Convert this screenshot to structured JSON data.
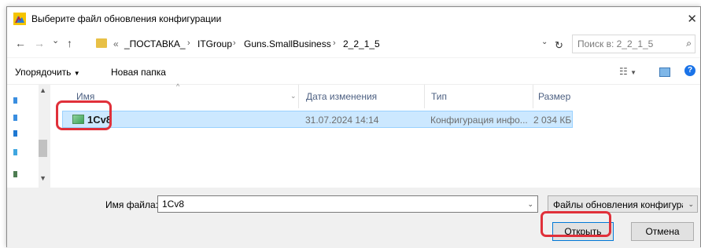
{
  "window": {
    "title": "Выберите файл обновления конфигурации",
    "close_glyph": "✕"
  },
  "nav": {
    "back_glyph": "←",
    "forward_glyph": "→",
    "recent_glyph": "⌄",
    "up_glyph": "↑",
    "overflow": "«",
    "path": [
      "_ПОСТАВКА_",
      "ITGroup",
      "Guns.SmallBusiness",
      "2_2_1_5"
    ],
    "path_separator": "›",
    "refresh_glyph": "↻",
    "search_placeholder": "Поиск в: 2_2_1_5",
    "search_glyph": "⌕"
  },
  "toolbar": {
    "organize_label": "Упорядочить",
    "new_folder_label": "Новая папка"
  },
  "columns": {
    "name": "Имя",
    "date": "Дата изменения",
    "type": "Тип",
    "size": "Размер"
  },
  "files": [
    {
      "name": "1Cv8",
      "date": "31.07.2024 14:14",
      "type": "Конфигурация инфо...",
      "size": "2 034 КБ"
    }
  ],
  "bottom": {
    "file_name_label": "Имя файла:",
    "file_name_value": "1Cv8",
    "filter_value": "Файлы обновления конфигура",
    "open_button": "Открыть",
    "cancel_button": "Отмена"
  },
  "colors": {
    "selection_bg": "#cce8ff",
    "highlight_red": "#e0303a",
    "accent_blue": "#0078d7"
  },
  "icons": {
    "title": "file-update-icon",
    "file": "config-file-icon",
    "help": "help-icon"
  }
}
